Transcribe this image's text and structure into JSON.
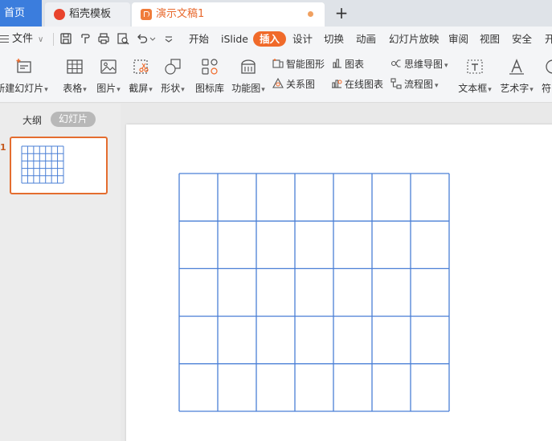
{
  "tabs": {
    "home": "首页",
    "templates": "稻壳模板",
    "document": "演示文稿1",
    "add": "+"
  },
  "menu": {
    "file": "文件",
    "items": [
      "开始",
      "iSlide",
      "插入",
      "设计",
      "切换",
      "动画",
      "幻灯片放映",
      "审阅",
      "视图",
      "安全",
      "开"
    ],
    "active_index": 2
  },
  "ribbon": {
    "new_slide": "新建幻灯片",
    "table": "表格",
    "picture": "图片",
    "screenshot": "截屏",
    "shape": "形状",
    "icon_library": "图标库",
    "function_chart": "功能图",
    "smart_shape": "智能图形",
    "chart": "图表",
    "relation_chart": "关系图",
    "online_chart": "在线图表",
    "mind_map": "思维导图",
    "flow_chart": "流程图",
    "text_box": "文本框",
    "art_text": "艺术字",
    "symbol": "符"
  },
  "panel": {
    "outline": "大纲",
    "slides": "幻灯片",
    "slide_number": "1"
  },
  "table": {
    "rows": 5,
    "cols": 7
  },
  "colors": {
    "accent": "#f06a2a",
    "home_tab": "#3b7ddd",
    "table_line": "#4a7fd6"
  }
}
